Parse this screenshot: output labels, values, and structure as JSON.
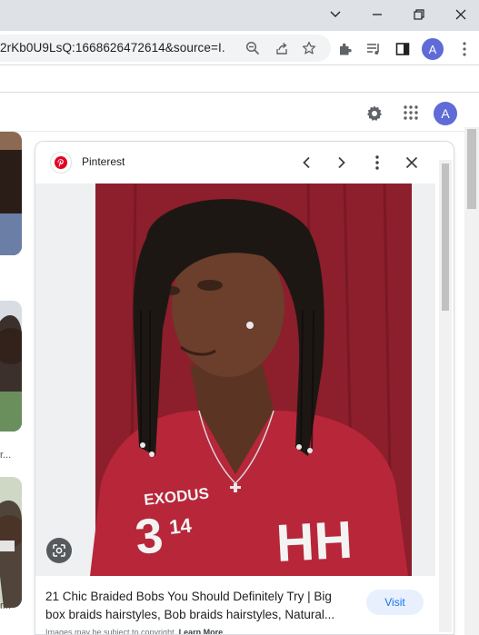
{
  "browser": {
    "url": "2rKb0U9LsQ:1668626472614&source=I...",
    "profile_initial": "A"
  },
  "google": {
    "avatar_initial": "A"
  },
  "left_strip": {
    "captions": [
      "r...",
      "r..."
    ]
  },
  "preview": {
    "source": "Pinterest",
    "title": "21 Chic Braided Bobs You Should Definitely Try | Big box braids hairstyles, Bob braids hairstyles, Natural...",
    "visit_label": "Visit",
    "copyright_prefix": "Images may be subject to copyright.",
    "learn_more": "Learn More",
    "shirt_text_top": "EXODUS",
    "shirt_number": "3",
    "shirt_superscript": "14",
    "shirt_letters": "HH"
  },
  "icons": {
    "pinterest_color": "#e60023",
    "shirt_color": "#b8263a",
    "backdrop_color": "#8c1f2b",
    "accent": "#1a73e8"
  }
}
